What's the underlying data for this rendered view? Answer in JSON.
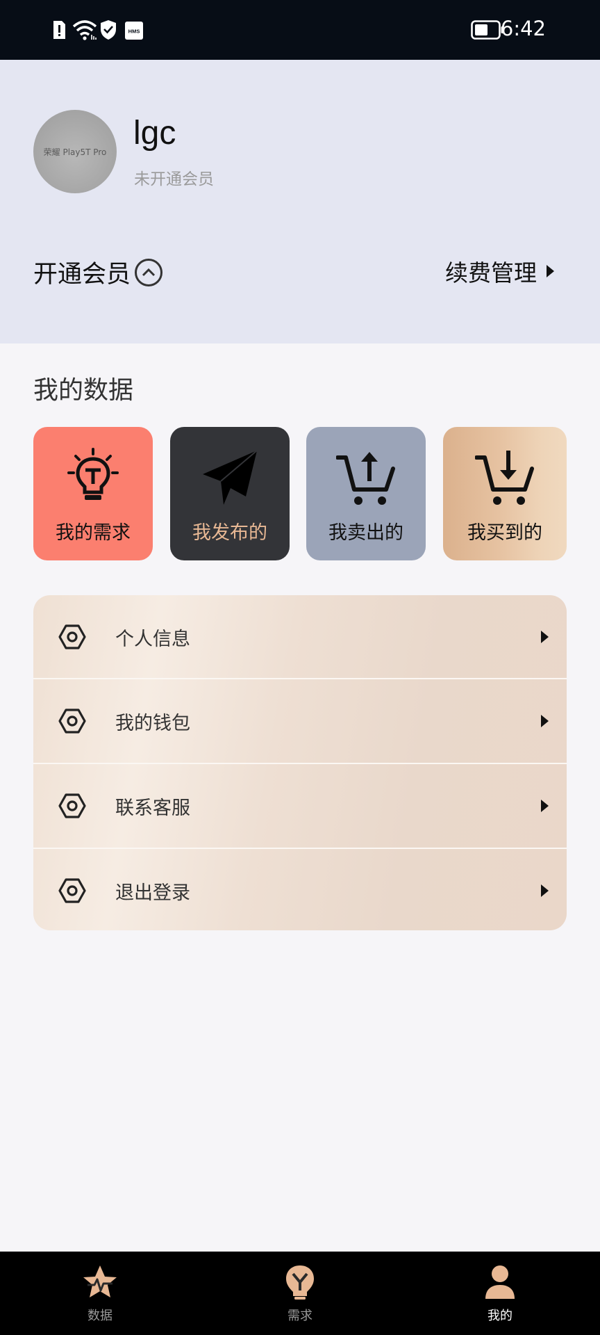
{
  "status_bar": {
    "time": "6:42",
    "icons": [
      "alert-icon",
      "wifi-icon",
      "shield-icon",
      "hms-icon",
      "battery-icon"
    ],
    "hms_text": "HMS"
  },
  "profile": {
    "avatar_text": "荣耀 Play5T Pro",
    "username": "lgc",
    "member_status": "未开通会员",
    "open_vip_label": "开通会员",
    "renew_label": "续费管理"
  },
  "my_data": {
    "title": "我的数据",
    "cards": [
      {
        "label": "我的需求",
        "icon": "lightbulb-icon",
        "bg": "#fb7f6f",
        "label_color": "#111111"
      },
      {
        "label": "我发布的",
        "icon": "paper-plane-icon",
        "bg": "#333438",
        "label_color": "#e8b894"
      },
      {
        "label": "我卖出的",
        "icon": "cart-upload-icon",
        "bg": "#9ba4b8",
        "label_color": "#111111"
      },
      {
        "label": "我买到的",
        "icon": "cart-download-icon",
        "bg": "#e6c2a1",
        "label_color": "#111111"
      }
    ]
  },
  "menu": {
    "items": [
      {
        "label": "个人信息",
        "icon": "hex-nut-icon"
      },
      {
        "label": "我的钱包",
        "icon": "hex-nut-icon"
      },
      {
        "label": "联系客服",
        "icon": "hex-nut-icon"
      },
      {
        "label": "退出登录",
        "icon": "hex-nut-icon"
      }
    ]
  },
  "bottom_nav": {
    "items": [
      {
        "label": "数据",
        "icon": "star-pulse-icon",
        "active": false
      },
      {
        "label": "需求",
        "icon": "bulb-y-icon",
        "active": false
      },
      {
        "label": "我的",
        "icon": "person-icon",
        "active": true
      }
    ],
    "active_color": "#ffffff",
    "inactive_color": "#9a9a9a",
    "icon_color": "#e8b894"
  }
}
